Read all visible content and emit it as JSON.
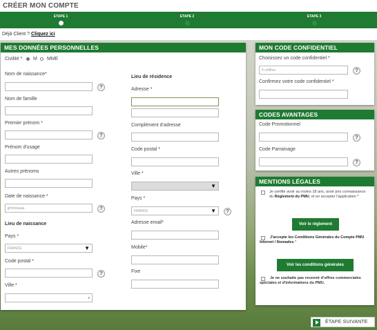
{
  "header": {
    "title": "CRÉER MON COMPTE"
  },
  "steps": [
    {
      "label": "ETAPE 1",
      "active": true
    },
    {
      "label": "ETAPE 2",
      "active": false
    },
    {
      "label": "ETAPE 3",
      "active": false
    }
  ],
  "already": {
    "text": "Déjà Client ?",
    "link": "Cliquez ici"
  },
  "personal": {
    "title": "MES DONNÉES PERSONNELLES",
    "civility_label": "Civilité *",
    "civility_m": "M",
    "civility_mme": "MME",
    "nom_naissance": "Nom de naissance*",
    "nom_famille": "Nom de famille",
    "premier_prenom": "Premier prénom *",
    "prenom_usage": "Prénom d'usage",
    "autres_prenoms": "Autres prénoms",
    "date_naissance": "Date de naissance *",
    "date_placeholder": "jj/mm/aaaa",
    "lieu_naissance_title": "Lieu de naissance",
    "pays_label": "Pays *",
    "pays_value": "FRANCE",
    "code_postal": "Code postal *",
    "ville": "Ville *",
    "lieu_residence_title": "Lieu de résidence",
    "adresse": "Adresse *",
    "complement": "Complément d'adresse",
    "code_postal_res": "Code postal *",
    "ville_res": "Ville *",
    "pays_res": "Pays *",
    "pays_res_value": "FRANCE",
    "email": "Adresse email*",
    "mobile": "Mobile*",
    "fixe": "Fixe"
  },
  "confidential": {
    "title": "MON CODE CONFIDENTIEL",
    "choose": "Choisissez un code confidentiel *",
    "placeholder": "6 chiffres",
    "confirm": "Confirmez votre code confidentiel *"
  },
  "codes": {
    "title": "CODES AVANTAGES",
    "promo": "Code Promotionnel",
    "parrainage": "Code Parrainage"
  },
  "legal": {
    "title": "MENTIONS LÉGALES",
    "check1_a": "Je certifie avoir au moins 18 ans, avoir pris connaissance du ",
    "check1_b": "Règlement du PMU",
    "check1_c": ", et en accepter l'application *",
    "btn_reglement": "Voir le règlement",
    "check2_a": "J'accepte les Conditions Générales du Compte PMU Internet / Nomades",
    "check2_b": " *",
    "btn_conditions": "Voir les conditions générales",
    "check3": "Je ne souhaite pas recevoir d'offres commerciales spéciales et d'informations du PMU."
  },
  "next": {
    "label": "ÉTAPE SUIVANTE"
  },
  "icons": {
    "help": "?",
    "dropdown": "▼",
    "small_dropdown": "▾"
  }
}
